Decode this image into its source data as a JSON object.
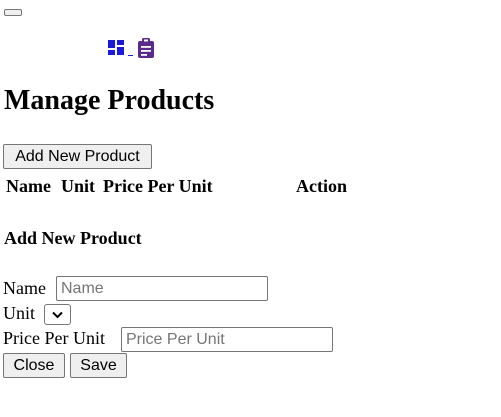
{
  "nav": {
    "toggler_label": ""
  },
  "icons": {
    "dashboard": "dashboard-icon",
    "orders": "clipboard-icon"
  },
  "page": {
    "title": "Manage Products",
    "add_button_label": "Add New Product"
  },
  "table": {
    "columns": [
      "Name",
      "Unit",
      "Price Per Unit",
      "Action"
    ],
    "rows": []
  },
  "modal": {
    "title": "Add New Product",
    "name_label": "Name",
    "name_placeholder": "Name",
    "unit_label": "Unit",
    "unit_selected": "",
    "price_label": "Price Per Unit",
    "price_placeholder": "Price Per Unit",
    "close_label": "Close",
    "save_label": "Save"
  },
  "colors": {
    "dashboard_icon": "#1a1adb",
    "clipboard_icon": "#5c2a8a",
    "link_underline": "#1a1adb"
  }
}
